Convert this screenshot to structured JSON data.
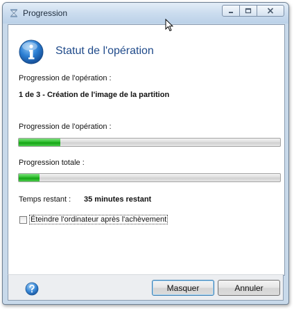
{
  "window": {
    "title": "Progression",
    "icons": {
      "app": "hourglass-icon",
      "minimize": "minimize-icon",
      "maximize": "maximize-icon",
      "close": "close-icon"
    }
  },
  "header": {
    "icon": "info-icon",
    "title": "Statut de l'opération"
  },
  "operation": {
    "label": "Progression de l'opération :",
    "current_step": "1 de 3 - Création de l'image de la partition"
  },
  "progress": {
    "operation_label": "Progression de l'opération :",
    "operation_value": 0.16,
    "total_label": "Progression totale :",
    "total_value": 0.08,
    "fill_color": "#22b422"
  },
  "time": {
    "label": "Temps restant :",
    "value": "35 minutes restant"
  },
  "option": {
    "label": "Éteindre l'ordinateur après l'achèvement",
    "checked": false
  },
  "footer": {
    "help_icon": "help-icon",
    "hide_label": "Masquer",
    "cancel_label": "Annuler"
  }
}
